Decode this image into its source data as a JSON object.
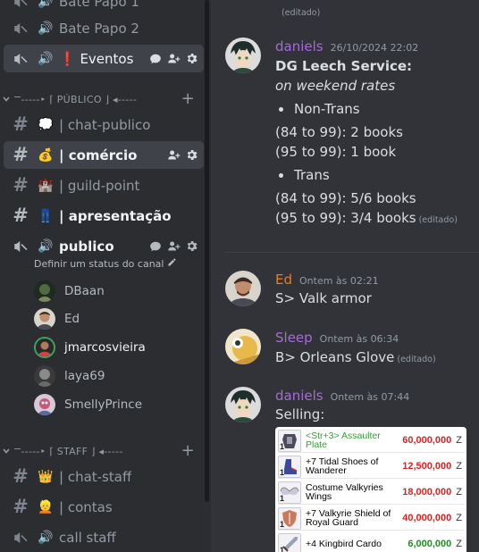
{
  "sidebar": {
    "voice_top": [
      {
        "name": "Bate Papo 1"
      },
      {
        "name": "Bate Papo 2"
      }
    ],
    "eventos": {
      "name": "❗ Eventos"
    },
    "categories": {
      "publico": "Ⲻ-----‣ ⌈ PÚBLICO ⌋ ◂-----",
      "staff": "Ⲻ-----‣ ⌈ STAFF ⌋ ◂-----"
    },
    "text_channels": [
      {
        "emoji": "💭",
        "name": "| chat-publico"
      },
      {
        "emoji": "💰",
        "name": "| comércio"
      },
      {
        "emoji": "🏰",
        "name": "| guild-point"
      },
      {
        "emoji": "👖",
        "name": "| apresentação"
      }
    ],
    "voice_publico": {
      "name": "publico",
      "status": "Definir um status do canal"
    },
    "voice_users": [
      {
        "name": "DBaan",
        "color": "#3a4a3a"
      },
      {
        "name": "Ed",
        "color": "#6b5a4a"
      },
      {
        "name": "jmarcosvieira",
        "color": "#3d8f55"
      },
      {
        "name": "laya69",
        "color": "#5a5a5a"
      },
      {
        "name": "SmellyPrince",
        "color": "#7a5a6a"
      }
    ],
    "staff_channels": [
      {
        "emoji": "👑",
        "name": "| chat-staff"
      },
      {
        "emoji": "👱",
        "name": "| contas"
      }
    ],
    "call_staff": {
      "name": "call staff"
    }
  },
  "chat": {
    "top_edited": "(editado)",
    "messages": [
      {
        "author": "daniels",
        "author_color": "#a56bd6",
        "timestamp": "26/10/2024 22:02",
        "title": "DG Leech Service:",
        "subtitle": "on weekend rates",
        "bullet1": "Non-Trans",
        "line1": "(84 to 99): 2 books",
        "line2": "(95 to 99): 1 book",
        "bullet2": "Trans",
        "line3": "(84 to 99): 5/6 books",
        "line4": "(95 to 99): 3/4 books",
        "edited": "(editado)"
      },
      {
        "author": "Ed",
        "author_color": "#e67e22",
        "timestamp": "Ontem às 02:21",
        "text": "S> Valk armor"
      },
      {
        "author": "Sleep",
        "author_color": "#a56bd6",
        "timestamp": "Ontem às 06:34",
        "text": "B> Orleans Glove",
        "edited": "(editado)"
      },
      {
        "author": "daniels",
        "author_color": "#a56bd6",
        "timestamp": "Ontem às 07:44",
        "text": "Selling:"
      }
    ],
    "shop_items": [
      {
        "qty": "1",
        "name": "<Str+3> Assaulter Plate",
        "name_color": "green",
        "price": "60,000,000",
        "price_color": "#e02020",
        "currency": "Z"
      },
      {
        "qty": "1",
        "name": "+7 Tidal Shoes of Wanderer",
        "name_color": "black",
        "price": "12,500,000",
        "price_color": "#e02020",
        "currency": "Z"
      },
      {
        "qty": "1",
        "name": "Costume Valkyries Wings",
        "name_color": "black",
        "price": "18,000,000",
        "price_color": "#e02020",
        "currency": "Z"
      },
      {
        "qty": "1",
        "name": "+7 Valkyrie Shield of Royal Guard",
        "name_color": "black",
        "price": "40,000,000",
        "price_color": "#e02020",
        "currency": "Z"
      },
      {
        "qty": "1",
        "name": "+4 Kingbird Cardo",
        "name_color": "black",
        "price": "6,000,000",
        "price_color": "#1d8f1d",
        "currency": "Z"
      }
    ]
  }
}
